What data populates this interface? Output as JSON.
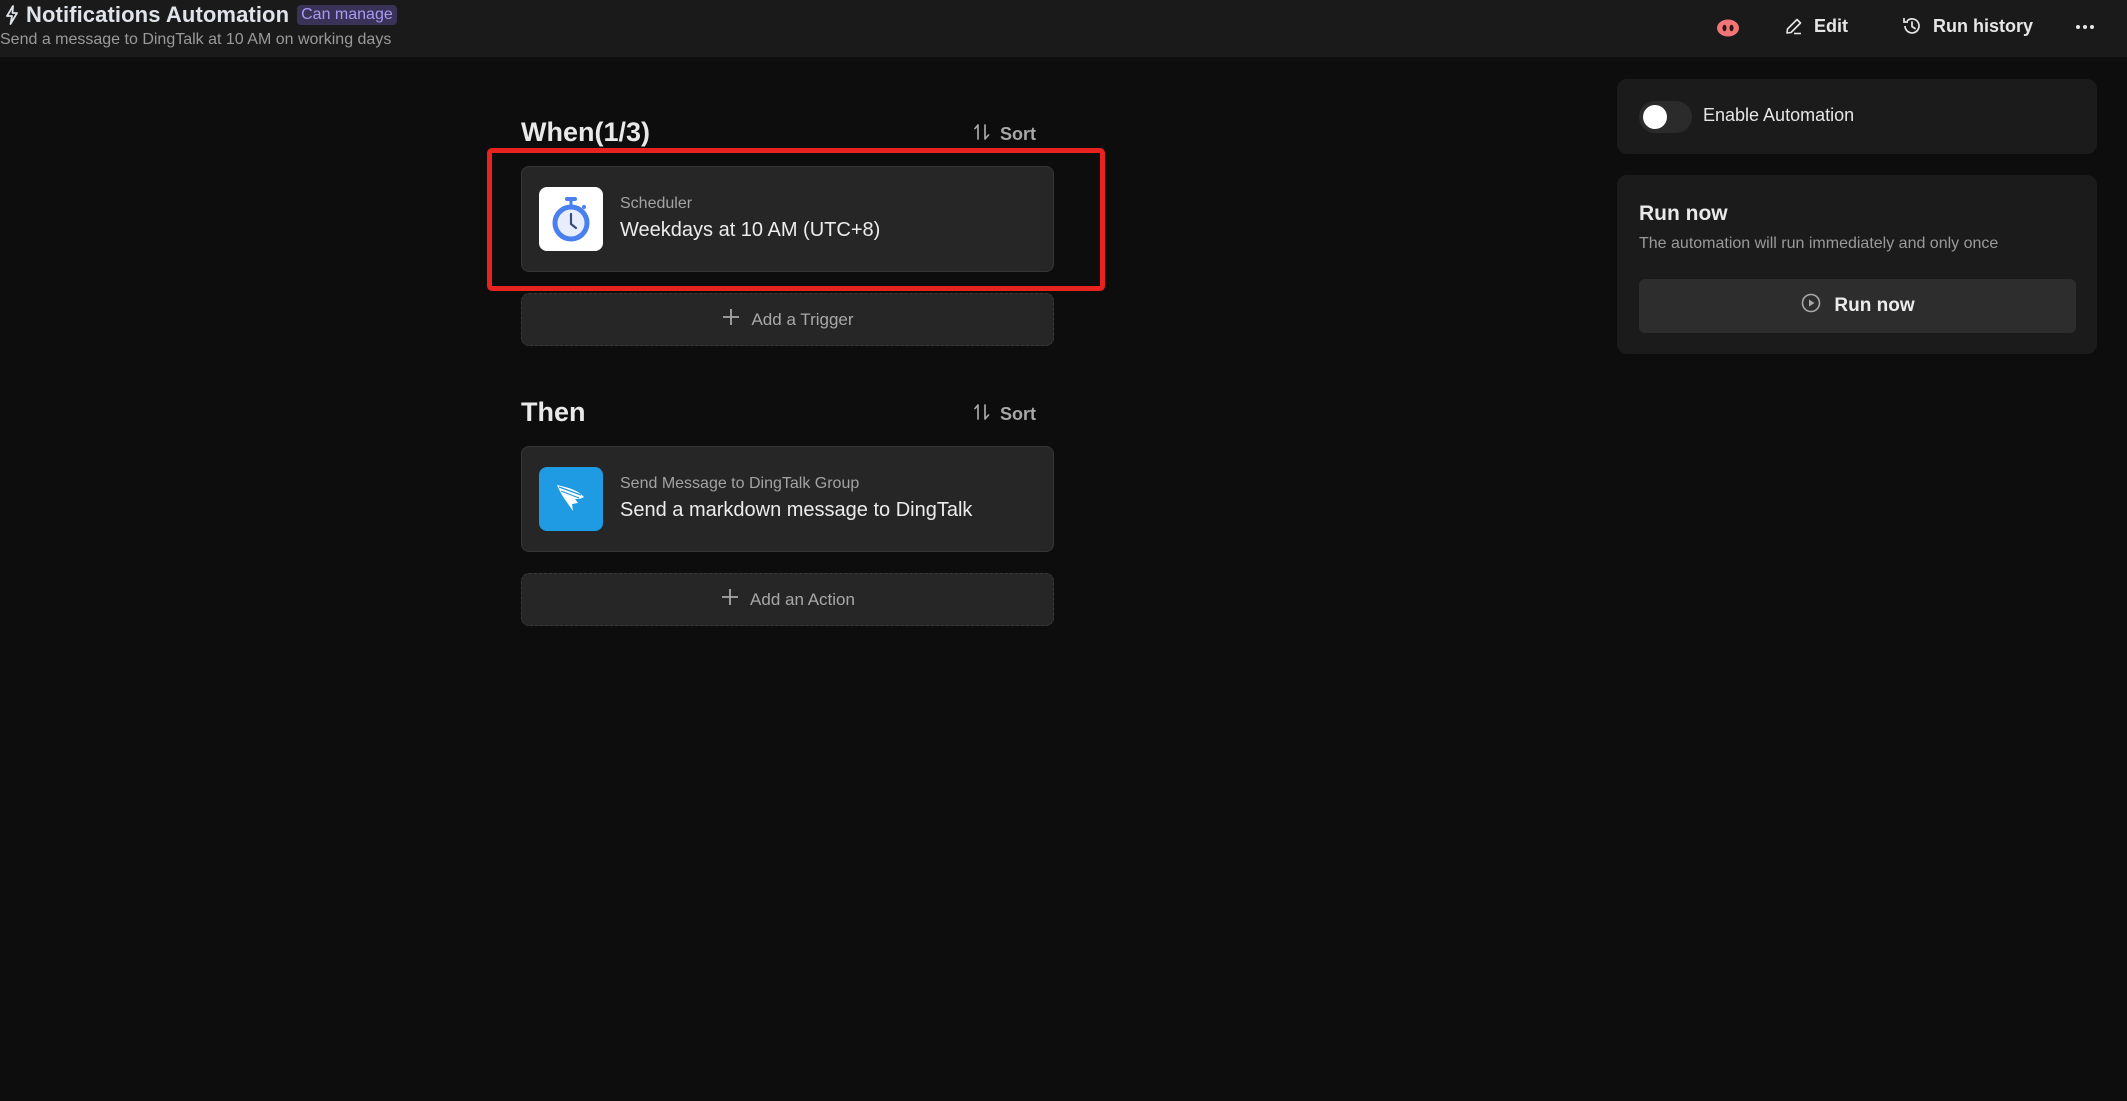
{
  "header": {
    "title": "Notifications Automation",
    "permission_badge": "Can manage",
    "subtitle": "Send a message to DingTalk at 10 AM on working days",
    "actions": {
      "edit_label": "Edit",
      "run_history_label": "Run history"
    }
  },
  "when_section": {
    "title": "When(1/3)",
    "sort_label": "Sort",
    "triggers": [
      {
        "icon": "stopwatch-icon",
        "label": "Scheduler",
        "value": "Weekdays at 10 AM (UTC+8)"
      }
    ],
    "add_label": "Add a Trigger"
  },
  "then_section": {
    "title": "Then",
    "sort_label": "Sort",
    "actions": [
      {
        "icon": "dingtalk-icon",
        "label": "Send Message to DingTalk Group",
        "value": "Send a markdown message to DingTalk"
      }
    ],
    "add_label": "Add an Action"
  },
  "side_panel": {
    "enable_label": "Enable Automation",
    "enabled": false,
    "run_now": {
      "title": "Run now",
      "description": "The automation will run immediately and only once",
      "button_label": "Run now"
    }
  },
  "colors": {
    "highlight": "#e8231f",
    "badge_text": "#a79af5",
    "dingtalk_blue": "#1e9be3",
    "scheduler_blue": "#4a7ff0"
  }
}
